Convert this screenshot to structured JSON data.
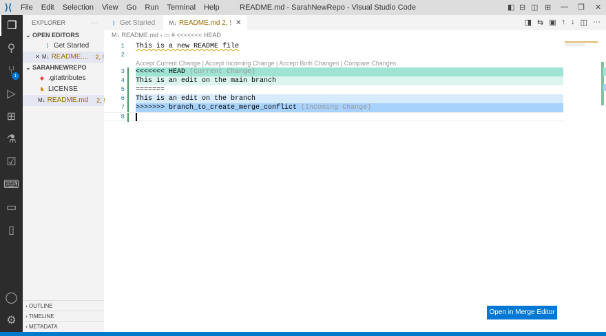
{
  "titlebar": {
    "menu": [
      "File",
      "Edit",
      "Selection",
      "View",
      "Go",
      "Run",
      "Terminal",
      "Help"
    ],
    "title": "README.md - SarahNewRepo - Visual Studio Code"
  },
  "activity": {
    "scm_badge": "1"
  },
  "sidebar": {
    "header": "EXPLORER",
    "more": "···",
    "open_editors": "OPEN EDITORS",
    "open_items": [
      {
        "label": "Get Started"
      },
      {
        "label": "README....",
        "badge": "2, !"
      }
    ],
    "repo": "SARAHNEWREPO",
    "files": [
      {
        "label": ".gitattributes"
      },
      {
        "label": "LICENSE"
      },
      {
        "label": "README.md",
        "badge": "2, !"
      }
    ],
    "outline": "OUTLINE",
    "timeline": "TIMELINE",
    "metadata": "METADATA"
  },
  "tabs": [
    {
      "label": "Get Started"
    },
    {
      "label": "README.md",
      "badge": "2, !"
    }
  ],
  "breadcrumb": {
    "file": "README.md",
    "symbol": "# <<<<<<< HEAD"
  },
  "codelens": {
    "accept_current": "Accept Current Change",
    "accept_incoming": "Accept Incoming Change",
    "accept_both": "Accept Both Changes",
    "compare": "Compare Changes",
    "sep": " | "
  },
  "lines": [
    {
      "n": "1",
      "text": "This is a new README file",
      "hint": ""
    },
    {
      "n": "2",
      "text": "",
      "hint": ""
    },
    {
      "n": "3",
      "text": "<<<<<<< HEAD",
      "hint": " (Current Change)"
    },
    {
      "n": "4",
      "text": "This is an edit on the main branch",
      "hint": ""
    },
    {
      "n": "5",
      "text": "=======",
      "hint": ""
    },
    {
      "n": "6",
      "text": "This is an edit on the branch",
      "hint": ""
    },
    {
      "n": "7",
      "text": ">>>>>>> branch_to_create_merge_conflict",
      "hint": " (Incoming Change)"
    },
    {
      "n": "8",
      "text": "",
      "hint": ""
    }
  ],
  "merge_button": "Open in Merge Editor"
}
